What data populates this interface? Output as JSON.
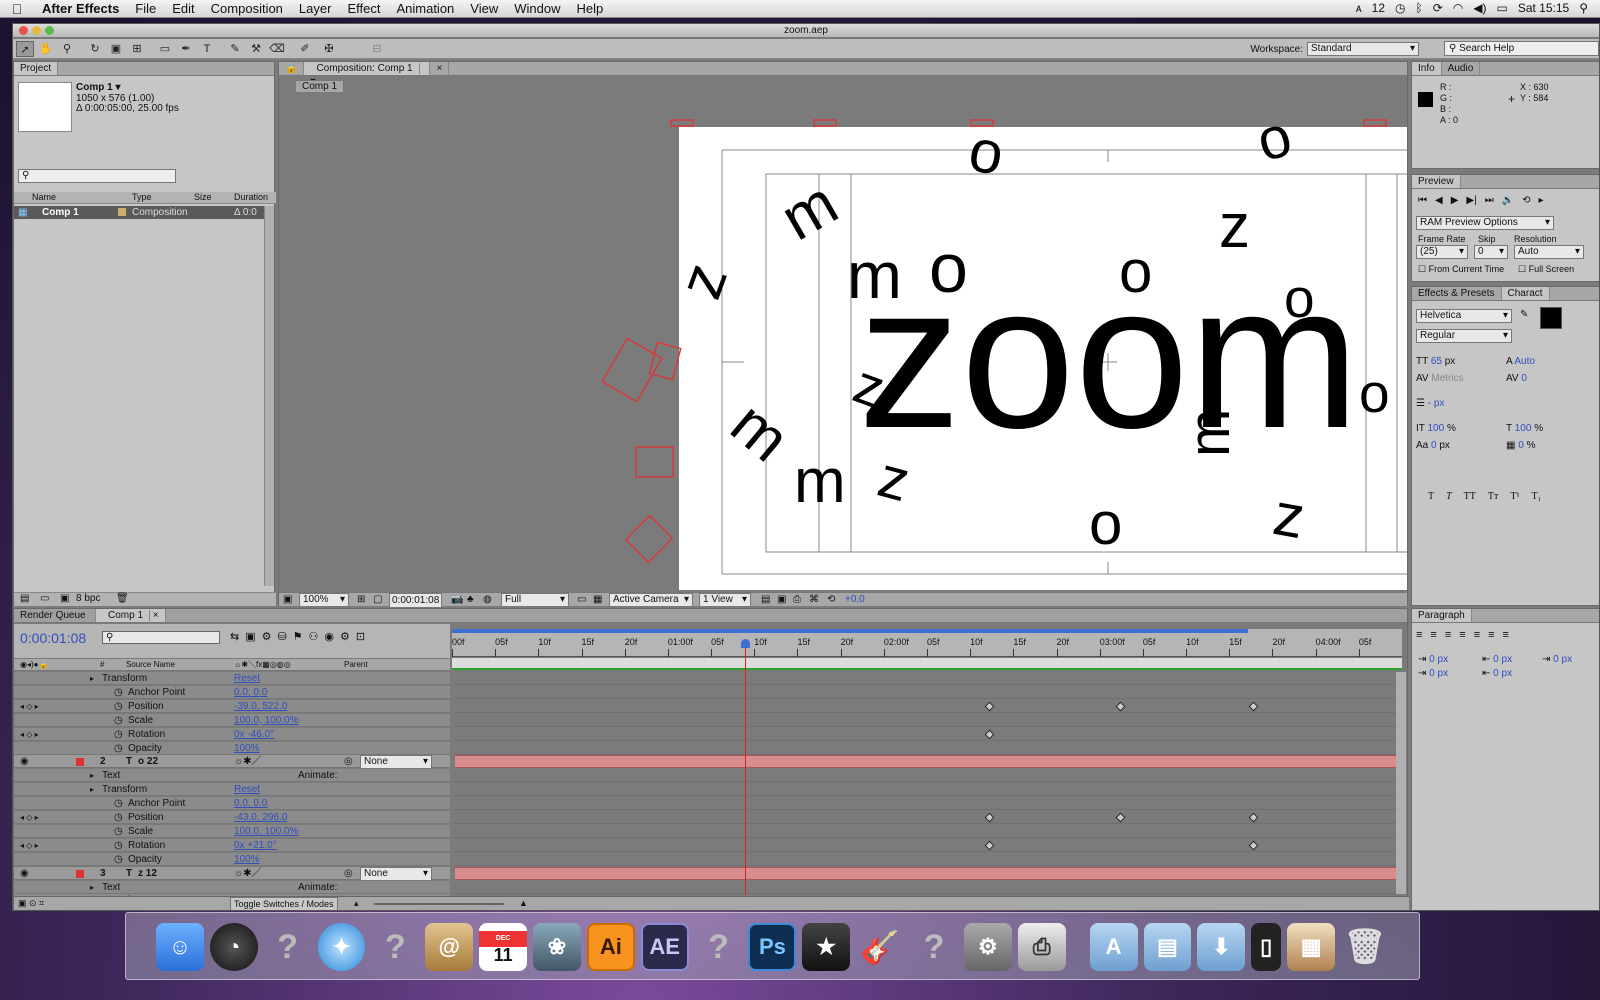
{
  "menubar": {
    "app": "After Effects",
    "items": [
      "File",
      "Edit",
      "Composition",
      "Layer",
      "Effect",
      "Animation",
      "View",
      "Window",
      "Help"
    ],
    "right": {
      "badge": "12",
      "clock": "Sat 15:15"
    }
  },
  "window": {
    "title": "zoom.aep"
  },
  "toolbar": {
    "workspace_label": "Workspace:",
    "workspace_value": "Standard",
    "search_help": "Search Help"
  },
  "project": {
    "tab": "Project",
    "comp_name": "Comp 1 ▾",
    "comp_size": "1050 x 576 (1.00)",
    "comp_duration": "Δ 0:00:05:00, 25.00 fps",
    "cols": [
      "Name",
      "Type",
      "Size",
      "Duration"
    ],
    "item_name": "Comp 1",
    "item_type": "Composition",
    "item_duration": "Δ 0:0",
    "bpc": "8 bpc"
  },
  "comp": {
    "tab": "Composition: Comp 1",
    "subtab": "Comp 1",
    "zoom_text": "zoom",
    "letters": [
      "m",
      "o",
      "z",
      "o",
      "m",
      "z",
      "o",
      "m",
      "o",
      "z",
      "m",
      "m",
      "z",
      "o",
      "z",
      "m",
      "o",
      "o",
      "z"
    ],
    "footer": {
      "zoom": "100%",
      "time": "0:00:01:08",
      "res": "Full",
      "camera": "Active Camera",
      "view": "1 View",
      "exposure": "+0.0"
    }
  },
  "info": {
    "tab1": "Info",
    "tab2": "Audio",
    "r": "R :",
    "g": "G :",
    "b": "B :",
    "a": "A : 0",
    "x": "X : 630",
    "y": "Y : 584"
  },
  "preview": {
    "tab": "Preview",
    "ram": "RAM Preview Options",
    "frame_rate_lbl": "Frame Rate",
    "skip_lbl": "Skip",
    "res_lbl": "Resolution",
    "frame_rate": "(25)",
    "skip": "0",
    "res": "Auto",
    "from_current": "From Current Time",
    "full_screen": "Full Screen"
  },
  "character": {
    "tab1": "Effects & Presets",
    "tab2": "Charact",
    "font": "Helvetica",
    "style": "Regular",
    "size": "65",
    "size_unit": "px",
    "leading": "Auto",
    "kerning": "Metrics",
    "tracking": "0",
    "stroke": "- px",
    "vscale": "100",
    "vscale_unit": "%",
    "hscale": "100",
    "hscale_unit": "%",
    "baseline": "0",
    "baseline_unit": "px",
    "tsume": "0",
    "tsume_unit": "%"
  },
  "paragraph": {
    "tab": "Paragraph",
    "v1": "0 px",
    "v2": "0 px",
    "v3": "0 px",
    "v4": "0 px",
    "v5": "0 px"
  },
  "timeline": {
    "tab1": "Render Queue",
    "tab2": "Comp 1",
    "time": "0:00:01:08",
    "col_source": "Source Name",
    "col_parent": "Parent",
    "col_num": "#",
    "ruler": [
      "00f",
      "05f",
      "10f",
      "15f",
      "20f",
      "01:00f",
      "05f",
      "10f",
      "15f",
      "20f",
      "02:00f",
      "05f",
      "10f",
      "15f",
      "20f",
      "03:00f",
      "05f",
      "10f",
      "15f",
      "20f",
      "04:00f",
      "05f"
    ],
    "rows": [
      {
        "label": "Transform",
        "value": "Reset"
      },
      {
        "label": "Anchor Point",
        "value": "0.0, 0.0"
      },
      {
        "label": "Position",
        "value": "-39.0, 522.0"
      },
      {
        "label": "Scale",
        "value": "100.0, 100.0%"
      },
      {
        "label": "Rotation",
        "value": "0x -46.0°"
      },
      {
        "label": "Opacity",
        "value": "100%"
      },
      {
        "label": "2",
        "value": "o 22",
        "parent": "None"
      },
      {
        "label": "Text",
        "value": "Animate:"
      },
      {
        "label": "Transform",
        "value": "Reset"
      },
      {
        "label": "Anchor Point",
        "value": "0.0, 0.0"
      },
      {
        "label": "Position",
        "value": "-43.0, 296.0"
      },
      {
        "label": "Scale",
        "value": "100.0, 100.0%"
      },
      {
        "label": "Rotation",
        "value": "0x +21.0°"
      },
      {
        "label": "Opacity",
        "value": "100%"
      },
      {
        "label": "3",
        "value": "z 12",
        "parent": "None"
      },
      {
        "label": "Text",
        "value": "Animate:"
      },
      {
        "label": "Transform",
        "value": "Reset"
      }
    ],
    "toggle": "Toggle Switches / Modes"
  },
  "dock": {
    "apps": [
      "Finder",
      "Dashboard",
      "?",
      "Safari",
      "?",
      "Address Book",
      "iCal",
      "iPhoto",
      "Ai",
      "AE",
      "?",
      "Ps",
      "iMovie",
      "GarageBand",
      "?",
      "System Preferences",
      "Printer",
      "Applications",
      "Documents",
      "Downloads",
      "iPhone",
      "Stack",
      "Trash"
    ],
    "ical_month": "DEC",
    "ical_day": "11"
  }
}
